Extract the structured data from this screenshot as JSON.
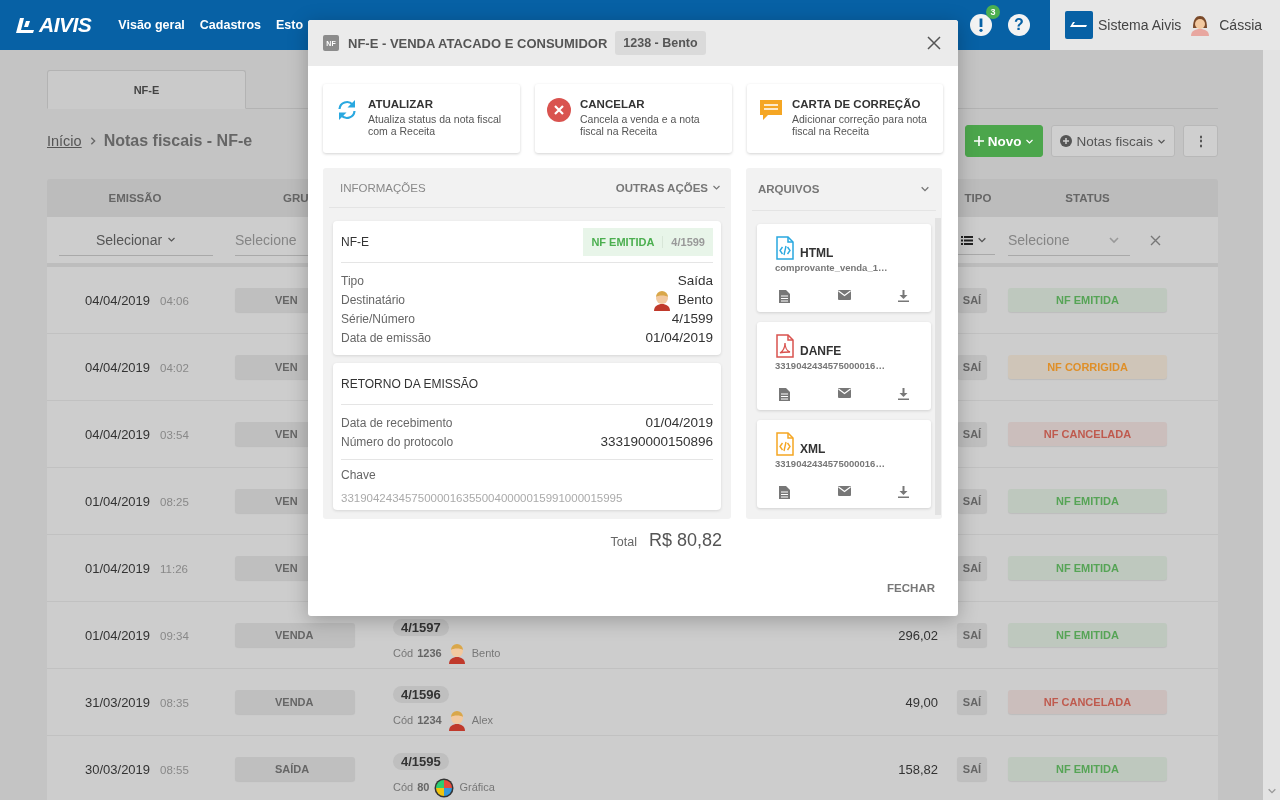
{
  "header": {
    "logo": "AIVIS",
    "nav": [
      "Visão geral",
      "Cadastros",
      "Esto"
    ],
    "notification_count": "3",
    "help": "?",
    "company": "Sistema Aivis",
    "user": "Cássia"
  },
  "tabs": [
    {
      "label": "NF-E",
      "selected": true
    }
  ],
  "breadcrumb": {
    "home": "Início",
    "current": "Notas fiscais - NF-e"
  },
  "toolbar": {
    "new_button": "Novo",
    "notes_button": "Notas fiscais",
    "more_button": "⋮"
  },
  "table": {
    "columns": [
      "EMISSÃO",
      "GRU",
      "TIPO",
      "STATUS"
    ],
    "filters": [
      {
        "kind": "dropdown",
        "value": "Selecionar"
      },
      {
        "kind": "text",
        "placeholder": "Selecione"
      },
      {
        "kind": "list"
      },
      {
        "kind": "select",
        "placeholder": "Selecione"
      }
    ],
    "rows": [
      {
        "date": "04/04/2019",
        "time": "04:06",
        "group": "VEN",
        "type": "SAÍ",
        "status": {
          "label": "NF EMITIDA",
          "color": "#56a456"
        }
      },
      {
        "date": "04/04/2019",
        "time": "04:02",
        "group": "VEN",
        "type": "SAÍ",
        "status": {
          "label": "NF CORRIGIDA",
          "color": "#df8f28"
        }
      },
      {
        "date": "04/04/2019",
        "time": "03:54",
        "group": "VEN",
        "type": "SAÍ",
        "status": {
          "label": "NF CANCELADA",
          "color": "#bf5a4e"
        }
      },
      {
        "date": "01/04/2019",
        "time": "08:25",
        "group": "VEN",
        "type": "SAÍ",
        "status": {
          "label": "NF EMITIDA",
          "color": "#56a456"
        }
      },
      {
        "date": "01/04/2019",
        "time": "11:26",
        "group": "VEN",
        "type": "SAÍ",
        "status": {
          "label": "NF EMITIDA",
          "color": "#56a456"
        }
      },
      {
        "date": "01/04/2019",
        "time": "09:34",
        "group": "VENDA",
        "number": "4/1597",
        "code_label": "Cód",
        "code": "1236",
        "customer": {
          "name": "Bento",
          "kind": "person"
        },
        "amount": "296,02",
        "type": "SAÍ",
        "status": {
          "label": "NF EMITIDA",
          "color": "#56a456"
        }
      },
      {
        "date": "31/03/2019",
        "time": "08:35",
        "group": "VENDA",
        "number": "4/1596",
        "code_label": "Cód",
        "code": "1234",
        "customer": {
          "name": "Alex",
          "kind": "person"
        },
        "amount": "49,00",
        "type": "SAÍ",
        "status": {
          "label": "NF CANCELADA",
          "color": "#bf5a4e"
        }
      },
      {
        "date": "30/03/2019",
        "time": "08:55",
        "group": "SAÍDA",
        "number": "4/1595",
        "code_label": "Cód",
        "code": "80",
        "customer": {
          "name": "Gráfica",
          "kind": "company"
        },
        "amount": "158,82",
        "type": "SAÍ",
        "status": {
          "label": "NF EMITIDA",
          "color": "#56a456"
        }
      }
    ]
  },
  "modal": {
    "badge": "NF",
    "title": "NF-E - VENDA ATACADO E CONSUMIDOR",
    "reference": "1238 - Bento",
    "actions": [
      {
        "kind": "refresh",
        "title": "ATUALIZAR",
        "description": "Atualiza status da nota fiscal com a Receita"
      },
      {
        "kind": "cancel",
        "title": "CANCELAR",
        "description": "Cancela a venda e a nota fiscal na Receita"
      },
      {
        "kind": "correction",
        "title": "CARTA DE CORREÇÃO",
        "description": "Adicionar correção para nota fiscal na Receita"
      }
    ],
    "info": {
      "title": "INFORMAÇÕES",
      "menu": "OUTRAS AÇÕES",
      "document": {
        "title": "NF-E",
        "status": "NF EMITIDA",
        "number": "4/1599",
        "fields": [
          {
            "kind": "text",
            "label": "Tipo",
            "value": "Saída"
          },
          {
            "kind": "person",
            "label": "Destinatário",
            "value": "Bento"
          },
          {
            "kind": "text",
            "label": "Série/Número",
            "value": "4/1599"
          },
          {
            "kind": "text",
            "label": "Data de emissão",
            "value": "01/04/2019"
          }
        ]
      },
      "return": {
        "title": "RETORNO DA EMISSÃO",
        "fields": [
          {
            "label": "Data de recebimento",
            "value": "01/04/2019"
          },
          {
            "label": "Número do protocolo",
            "value": "333190000150896"
          }
        ],
        "key_label": "Chave",
        "key": "33190424345750000163550040000015991000015995"
      }
    },
    "total_label": "Total",
    "total": "R$ 80,82",
    "files": {
      "title": "ARQUIVOS",
      "items": [
        {
          "kind": "html",
          "name": "HTML",
          "file": "comprovante_venda_1…"
        },
        {
          "kind": "pdf",
          "name": "DANFE",
          "file": "3319042434575000016…"
        },
        {
          "kind": "xml",
          "name": "XML",
          "file": "3319042434575000016…"
        }
      ]
    },
    "close": "FECHAR"
  }
}
